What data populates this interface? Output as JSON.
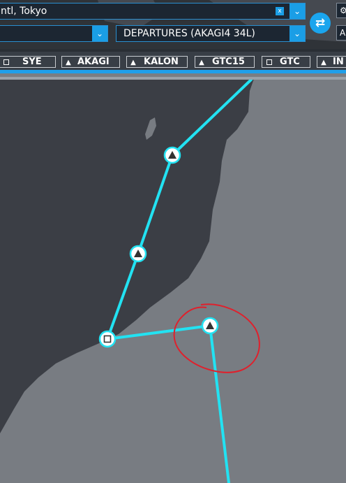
{
  "route": {
    "origin_value": "ntl, Tokyo",
    "departure_value": "DEPARTURES (AKAGI4 34L)",
    "right_button_glyph": "A",
    "swap_glyph": "⇄",
    "clear_glyph": "x",
    "chevron_glyph": "⌄"
  },
  "waypoints": [
    {
      "name": "SYE",
      "kind": "vor"
    },
    {
      "name": "AKAGI",
      "kind": "triangle"
    },
    {
      "name": "KALON",
      "kind": "triangle"
    },
    {
      "name": "GTC15",
      "kind": "triangle"
    },
    {
      "name": "GTC",
      "kind": "vor"
    },
    {
      "name": "IN",
      "kind": "triangle"
    }
  ],
  "colors": {
    "land": "#787c82",
    "water": "#3b3e45",
    "route": "#22e2f2",
    "annotation": "#e0202c",
    "accent": "#1a9ee6"
  }
}
